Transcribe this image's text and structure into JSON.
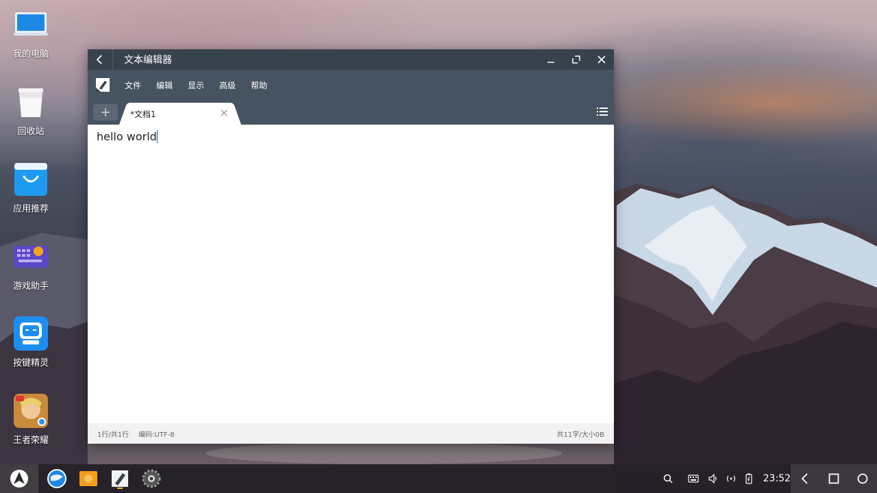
{
  "desktop": {
    "icons": [
      {
        "label": "我的电脑",
        "icon": "computer-icon"
      },
      {
        "label": "回收站",
        "icon": "recycle-bin-icon"
      },
      {
        "label": "应用推荐",
        "icon": "app-store-icon"
      },
      {
        "label": "游戏助手",
        "icon": "game-assistant-icon"
      },
      {
        "label": "按键精灵",
        "icon": "key-macro-icon"
      },
      {
        "label": "王者荣耀",
        "icon": "game-icon"
      }
    ]
  },
  "window": {
    "title": "文本编辑器",
    "menu": [
      "文件",
      "编辑",
      "显示",
      "高级",
      "帮助"
    ],
    "tab": {
      "label": "*文档1"
    },
    "content": "hello world",
    "status": {
      "position": "1行/共1行",
      "encoding": "编码:UTF-8",
      "size": "共11字/大小0B"
    }
  },
  "taskbar": {
    "clock": "23:52",
    "apps": [
      "browser-icon",
      "files-icon",
      "text-editor-icon",
      "settings-icon"
    ],
    "tray": [
      "search-icon",
      "keyboard-icon",
      "volume-icon",
      "signal-icon",
      "battery-icon"
    ]
  },
  "colors": {
    "titlebar": "#37424d",
    "menubar": "#465360",
    "accent": "#1e88e5"
  }
}
